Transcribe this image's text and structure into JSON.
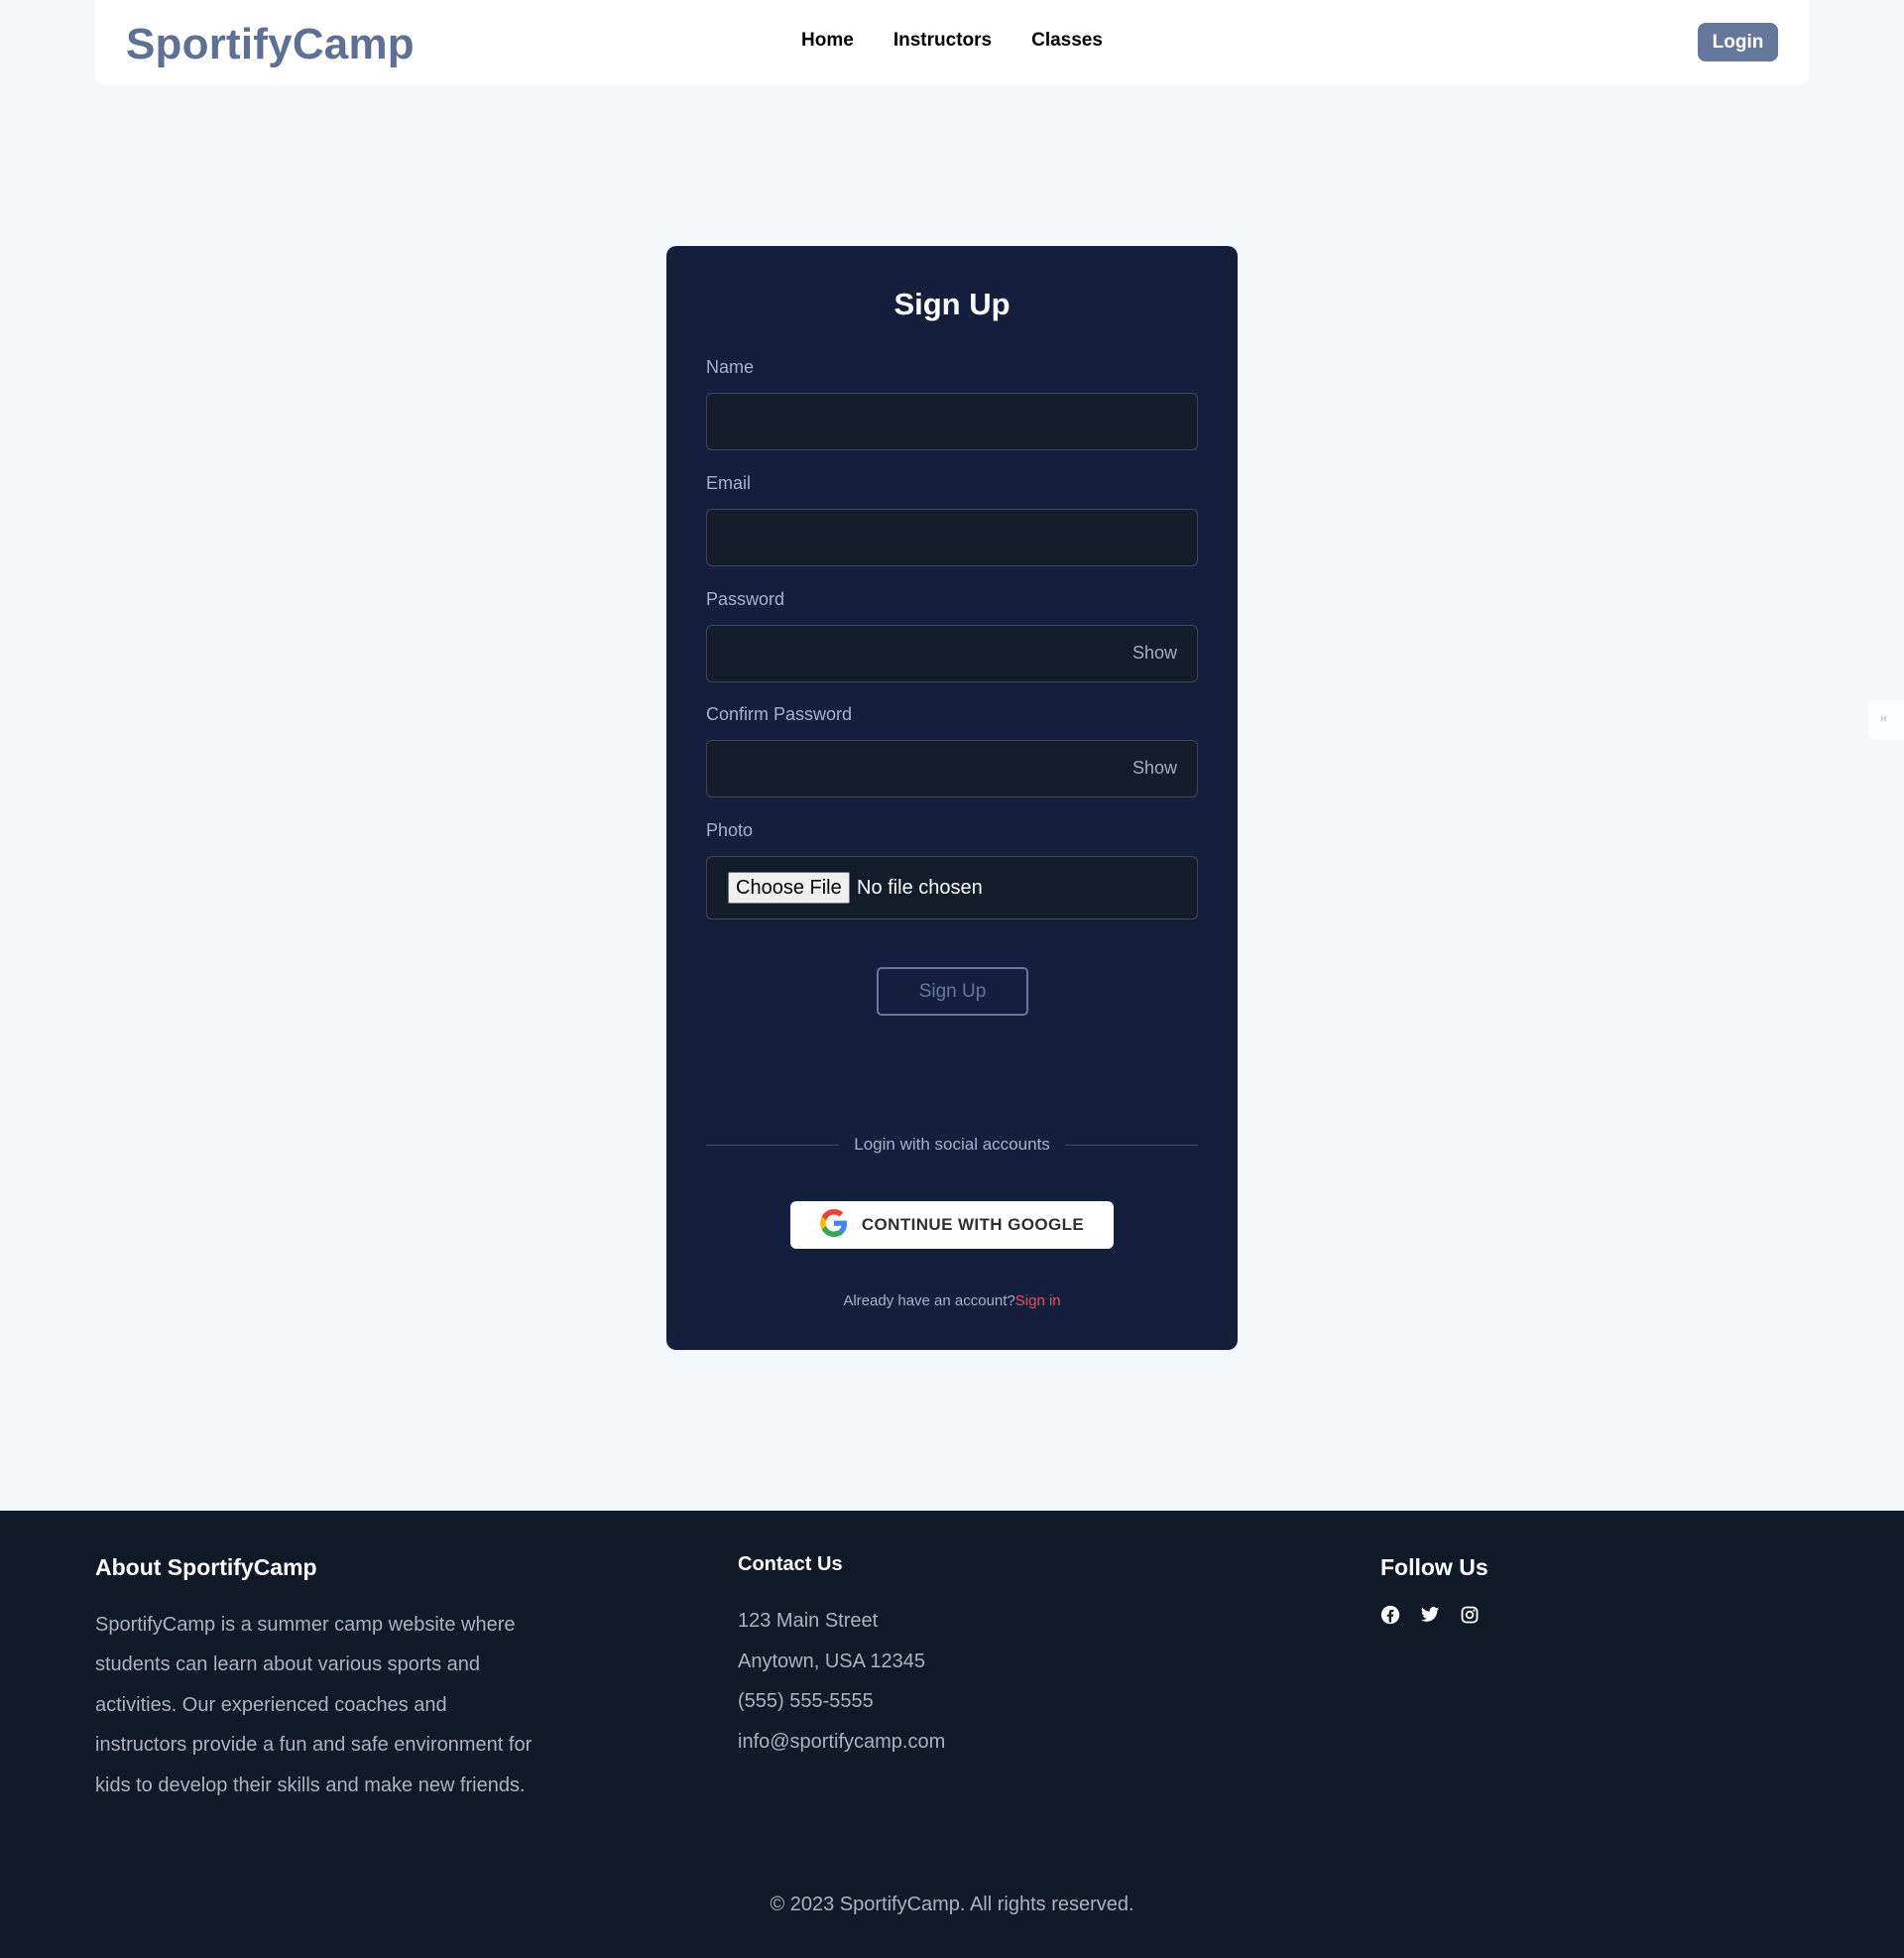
{
  "navbar": {
    "brand": "SportifyCamp",
    "links": [
      "Home",
      "Instructors",
      "Classes"
    ],
    "login_label": "Login"
  },
  "signup": {
    "title": "Sign Up",
    "name_label": "Name",
    "email_label": "Email",
    "password_label": "Password",
    "confirm_label": "Confirm Password",
    "show_label": "Show",
    "photo_label": "Photo",
    "choose_file_label": "Choose File",
    "no_file_text": "No file chosen",
    "submit_label": "Sign Up",
    "social_divider": "Login with social accounts",
    "google_label": "CONTINUE WITH GOOGLE",
    "already_text": "Already have an account?",
    "signin_label": "Sign in"
  },
  "footer": {
    "about_title": "About SportifyCamp",
    "about_text": "SportifyCamp is a summer camp website where students can learn about various sports and activities. Our experienced coaches and instructors provide a fun and safe environment for kids to develop their skills and make new friends.",
    "contact_title": "Contact Us",
    "contact_lines": [
      "123 Main Street",
      "Anytown, USA 12345",
      "(555) 555-5555",
      "info@sportifycamp.com"
    ],
    "follow_title": "Follow Us",
    "social_icons": [
      "facebook-icon",
      "twitter-icon",
      "instagram-icon"
    ],
    "copyright": "© 2023 SportifyCamp. All rights reserved."
  },
  "colors": {
    "page_bg": "#f5f8fa",
    "card_bg": "#131f3d",
    "footer_bg": "#111827",
    "brand": "#5e7094",
    "accent_link": "#ef4e5c"
  }
}
